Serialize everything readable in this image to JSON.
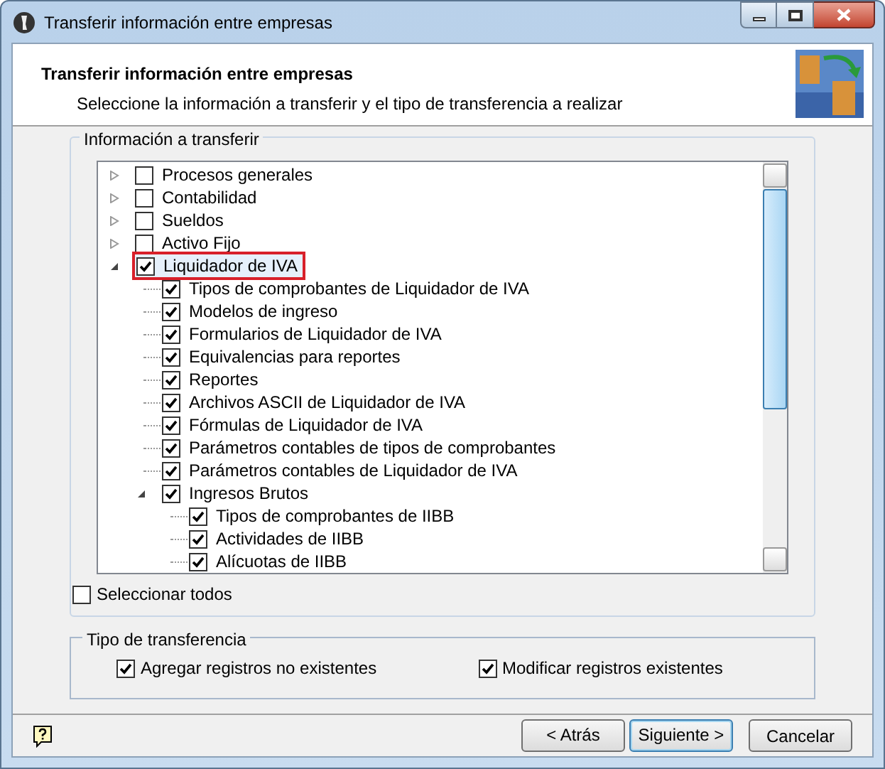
{
  "window": {
    "title": "Transferir información entre empresas"
  },
  "header": {
    "title": "Transferir información entre empresas",
    "subtitle": "Seleccione la información a transferir y el tipo de transferencia a realizar"
  },
  "info_group": {
    "legend": "Información a transferir",
    "tree": [
      {
        "label": "Procesos generales",
        "checked": false,
        "expanded": false,
        "highlighted": false
      },
      {
        "label": "Contabilidad",
        "checked": false,
        "expanded": false,
        "highlighted": false
      },
      {
        "label": "Sueldos",
        "checked": false,
        "expanded": false,
        "highlighted": false
      },
      {
        "label": "Activo Fijo",
        "checked": false,
        "expanded": false,
        "highlighted": false
      },
      {
        "label": "Liquidador de IVA",
        "checked": true,
        "expanded": true,
        "highlighted": true,
        "children": [
          {
            "label": "Tipos de comprobantes de Liquidador de IVA",
            "checked": true
          },
          {
            "label": "Modelos de ingreso",
            "checked": true
          },
          {
            "label": "Formularios de Liquidador de IVA",
            "checked": true
          },
          {
            "label": "Equivalencias para reportes",
            "checked": true
          },
          {
            "label": "Reportes",
            "checked": true
          },
          {
            "label": "Archivos ASCII de Liquidador de IVA",
            "checked": true
          },
          {
            "label": "Fórmulas de Liquidador de IVA",
            "checked": true
          },
          {
            "label": "Parámetros contables de tipos de comprobantes",
            "checked": true
          },
          {
            "label": "Parámetros contables de Liquidador de IVA",
            "checked": true
          },
          {
            "label": "Ingresos Brutos",
            "checked": true,
            "expanded": true,
            "children": [
              {
                "label": "Tipos de comprobantes de IIBB",
                "checked": true
              },
              {
                "label": "Actividades de IIBB",
                "checked": true
              },
              {
                "label": "Alícuotas de IIBB",
                "checked": true
              }
            ]
          }
        ]
      }
    ],
    "select_all": {
      "label": "Seleccionar todos",
      "checked": false
    }
  },
  "transfer_group": {
    "legend": "Tipo de transferencia",
    "options": [
      {
        "label": "Agregar registros no existentes",
        "checked": true
      },
      {
        "label": "Modificar registros existentes",
        "checked": true
      }
    ]
  },
  "buttons": [
    {
      "label": "< Atrás",
      "default": false
    },
    {
      "label": "Siguiente >",
      "default": true
    },
    {
      "label": "Cancelar",
      "default": false
    }
  ]
}
